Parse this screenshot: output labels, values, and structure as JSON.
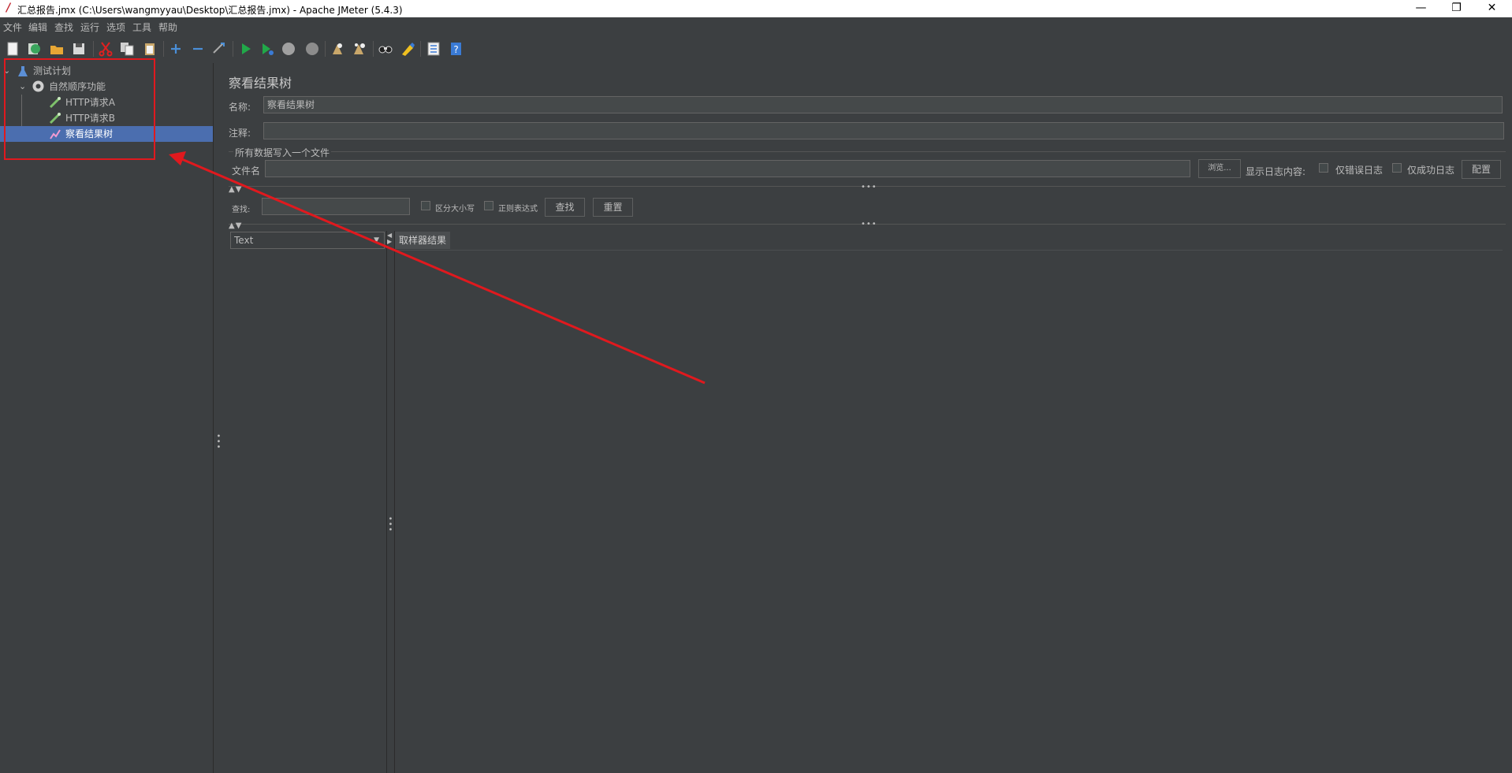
{
  "window": {
    "title": "汇总报告.jmx (C:\\Users\\wangmyyau\\Desktop\\汇总报告.jmx) - Apache JMeter (5.4.3)",
    "minimize": "—",
    "restore": "❐",
    "close": "✕"
  },
  "menu": [
    "文件",
    "编辑",
    "查找",
    "运行",
    "选项",
    "工具",
    "帮助"
  ],
  "toolbar": [
    "new-icon",
    "templates-icon",
    "open-icon",
    "save-icon",
    "cut-icon",
    "copy-icon",
    "paste-icon",
    "expand-icon",
    "collapse-icon",
    "toggle-icon",
    "start-icon",
    "start-no-pause-icon",
    "stop-icon",
    "shutdown-icon",
    "clear-icon",
    "clear-all-icon",
    "search-icon",
    "reset-search-icon",
    "function-helper-icon",
    "help-icon"
  ],
  "tree": [
    {
      "label": "测试计划",
      "icon": "test-plan-icon"
    },
    {
      "label": "自然顺序功能",
      "icon": "thread-group-icon"
    },
    {
      "label": "HTTP请求A",
      "icon": "sampler-icon"
    },
    {
      "label": "HTTP请求B",
      "icon": "sampler-icon"
    },
    {
      "label": "察看结果树",
      "icon": "listener-icon"
    }
  ],
  "panel": {
    "heading": "察看结果树",
    "name_label": "名称:",
    "name_value": "察看结果树",
    "comment_label": "注释:",
    "comment_value": "",
    "file_group_label": "所有数据写入一个文件",
    "filename_label": "文件名",
    "filename_value": "",
    "browse_label": "浏览...",
    "log_label": "显示日志内容:",
    "errors_only": "仅错误日志",
    "success_only": "仅成功日志",
    "configure": "配置",
    "search_label": "查找:",
    "search_value": "",
    "case_sensitive": "区分大小写",
    "regex": "正则表达式",
    "find_button": "查找",
    "reset_button": "重置",
    "render_select": "Text",
    "results_tab": "取样器结果"
  },
  "colors": {
    "background": "#3c3f41",
    "selection": "#4b6eaf",
    "annotation": "#e0191e"
  }
}
